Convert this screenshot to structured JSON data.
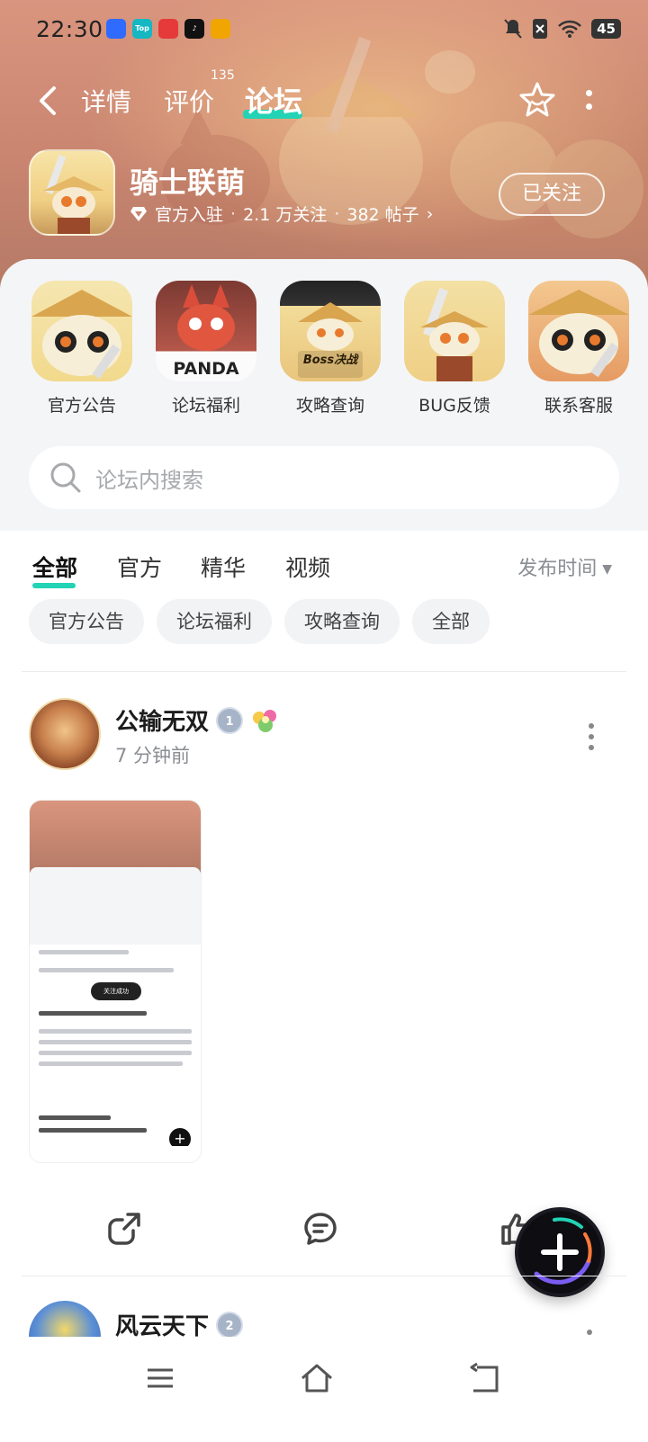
{
  "status_bar": {
    "time": "22:30",
    "battery": "45",
    "app_badges": [
      {
        "name": "app-icon-1",
        "color": "#2f6bff",
        "text": ""
      },
      {
        "name": "app-icon-2",
        "color": "#15b7c3",
        "text": "Top"
      },
      {
        "name": "app-icon-3",
        "color": "#e63a3a",
        "text": ""
      },
      {
        "name": "app-icon-4",
        "color": "#111111",
        "text": ""
      },
      {
        "name": "app-icon-5",
        "color": "#f0a500",
        "text": ""
      }
    ]
  },
  "nav": {
    "tabs": [
      {
        "label": "详情"
      },
      {
        "label": "评价",
        "count": "135"
      },
      {
        "label": "论坛",
        "active": true
      }
    ]
  },
  "game": {
    "name": "骑士联萌",
    "official": "官方入驻",
    "followers": "2.1 万关注",
    "posts": "382 帖子",
    "follow_label": "已关注"
  },
  "shortcuts": [
    {
      "label": "官方公告"
    },
    {
      "label": "论坛福利",
      "icon_text": "PANDA"
    },
    {
      "label": "攻略查询",
      "icon_text": "Boss决战"
    },
    {
      "label": "BUG反馈"
    },
    {
      "label": "联系客服"
    }
  ],
  "search": {
    "placeholder": "论坛内搜索"
  },
  "filter": {
    "tabs": [
      "全部",
      "官方",
      "精华",
      "视频"
    ],
    "sort_label": "发布时间"
  },
  "chips": [
    "官方公告",
    "论坛福利",
    "攻略查询",
    "全部"
  ],
  "posts": [
    {
      "author": "公输无双",
      "level": "1",
      "time": "7 分钟前",
      "thumb": {
        "toast": "关注成功",
        "fab": "+"
      }
    },
    {
      "author": "风云天下",
      "level": "2"
    }
  ],
  "colors": {
    "accent": "#22d3b5",
    "hero": "#c98570"
  }
}
